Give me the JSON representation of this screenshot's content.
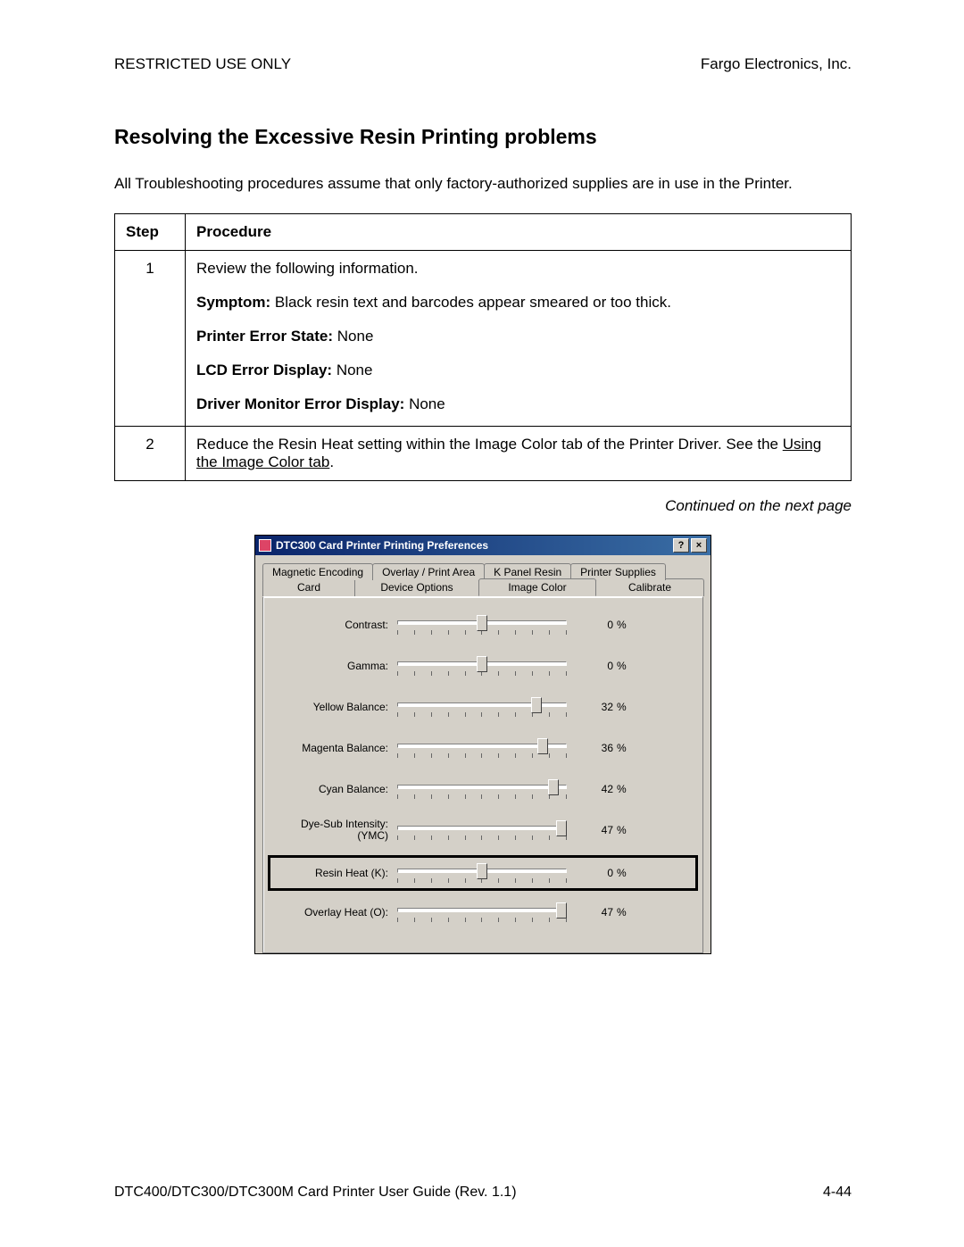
{
  "header": {
    "left": "RESTRICTED USE ONLY",
    "right": "Fargo Electronics, Inc."
  },
  "title": "Resolving the Excessive Resin Printing problems",
  "intro": "All Troubleshooting procedures assume that only factory-authorized supplies are in use in the Printer.",
  "table": {
    "head_step": "Step",
    "head_proc": "Procedure",
    "rows": [
      {
        "step": "1",
        "lead": "Review the following information.",
        "symptom_label": "Symptom:",
        "symptom_text": "Black resin text and barcodes appear smeared or too thick.",
        "pes_label": "Printer Error State:",
        "pes_text": "None",
        "lcd_label": "LCD Error Display:",
        "lcd_text": "None",
        "dme_label": "Driver Monitor Error Display:",
        "dme_text": "None"
      },
      {
        "step": "2",
        "text_a": "Reduce the Resin Heat setting within the Image Color tab of the Printer Driver. See the ",
        "link": "Using the Image Color tab",
        "text_b": "."
      }
    ]
  },
  "cont": "Continued on the next page",
  "dialog": {
    "title": "DTC300 Card Printer Printing Preferences",
    "help_btn": "?",
    "close_btn": "×",
    "tabs_back": [
      "Magnetic Encoding",
      "Overlay / Print Area",
      "K Panel Resin",
      "Printer Supplies"
    ],
    "tabs_front": [
      "Card",
      "Device Options",
      "Image Color",
      "Calibrate"
    ],
    "sliders": [
      {
        "label": "Contrast:",
        "value": "0",
        "pos": 50,
        "hl": false
      },
      {
        "label": "Gamma:",
        "value": "0",
        "pos": 50,
        "hl": false
      },
      {
        "label": "Yellow Balance:",
        "value": "32",
        "pos": 82,
        "hl": false
      },
      {
        "label": "Magenta Balance:",
        "value": "36",
        "pos": 86,
        "hl": false
      },
      {
        "label": "Cyan Balance:",
        "value": "42",
        "pos": 92,
        "hl": false
      },
      {
        "label": "Dye-Sub Intensity:\n(YMC)",
        "value": "47",
        "pos": 97,
        "hl": false
      },
      {
        "label": "Resin Heat  (K):",
        "value": "0",
        "pos": 50,
        "hl": true
      },
      {
        "label": "Overlay Heat  (O):",
        "value": "47",
        "pos": 97,
        "hl": false
      }
    ],
    "unit": "%"
  },
  "footer": {
    "left": "DTC400/DTC300/DTC300M Card Printer User Guide (Rev. 1.1)",
    "right": "4-44"
  }
}
